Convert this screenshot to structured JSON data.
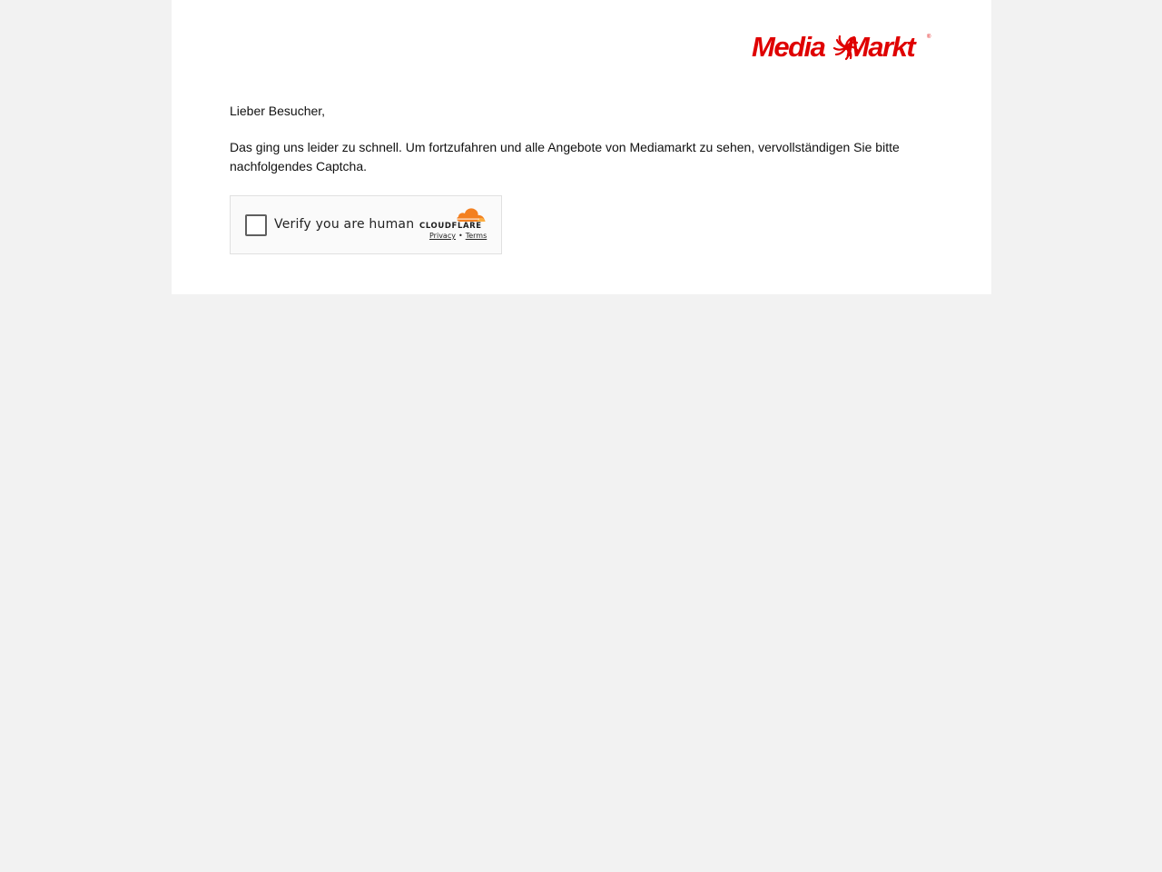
{
  "brand": {
    "logo_left": "Media",
    "logo_right": "Markt",
    "logo_reg": "®",
    "color": "#df0000"
  },
  "content": {
    "greeting": "Lieber Besucher,",
    "message": "Das ging uns leider zu schnell. Um fortzufahren und alle Angebote von Mediamarkt zu sehen, vervollständigen Sie bitte nachfolgendes Captcha."
  },
  "captcha": {
    "label": "Verify you are human",
    "provider": "CLOUDFLARE",
    "privacy_link": "Privacy",
    "separator": "•",
    "terms_link": "Terms",
    "checked": false,
    "accent_color": "#f38020"
  }
}
